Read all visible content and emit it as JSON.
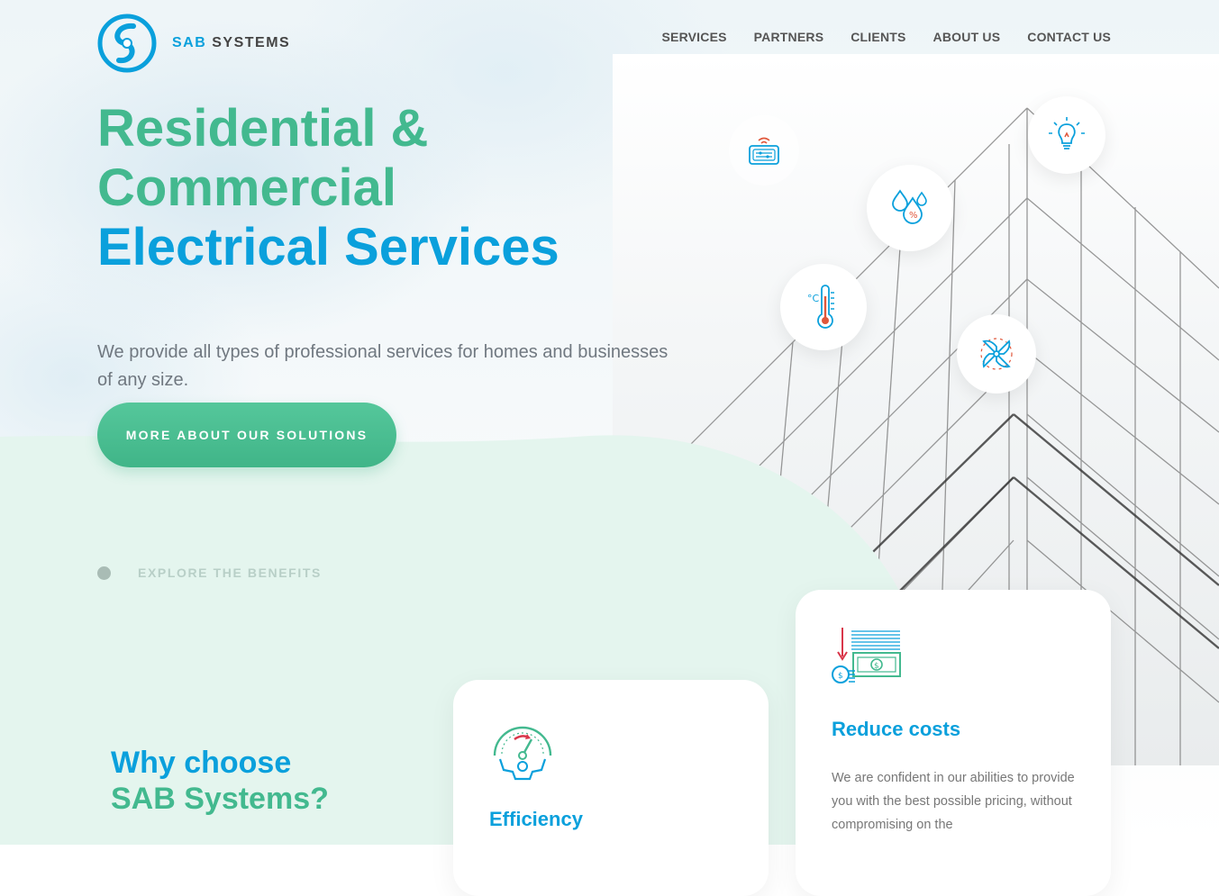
{
  "brand": {
    "name_part1": "SAB",
    "name_part2": "SYSTEMS"
  },
  "nav": [
    "SERVICES",
    "PARTNERS",
    "CLIENTS",
    "ABOUT US",
    "CONTACT US"
  ],
  "hero": {
    "title_line1": "Residential &",
    "title_line2": "Commercial",
    "title_line3": "Electrical Services",
    "subtitle": "We provide all types of professional services for homes and businesses of any size.",
    "cta_label": "MORE ABOUT OUR SOLUTIONS"
  },
  "explore_label": "EXPLORE THE BENEFITS",
  "feature_icons": [
    "smart-thermostat-icon",
    "lightbulb-icon",
    "humidity-icon",
    "thermometer-icon",
    "fan-icon"
  ],
  "why": {
    "line1": "Why choose",
    "line2": "SAB Systems?"
  },
  "cards": [
    {
      "icon": "gauge-gear-icon",
      "title": "Efficiency",
      "text": ""
    },
    {
      "icon": "money-chart-icon",
      "title": "Reduce costs",
      "text": "We are confident in our abilities to provide you with the best possible pricing, without compromising on the"
    }
  ],
  "colors": {
    "green": "#43b98f",
    "blue": "#0aa0dc",
    "mint_bg": "#e4f5ee",
    "text_gray": "#707880"
  }
}
